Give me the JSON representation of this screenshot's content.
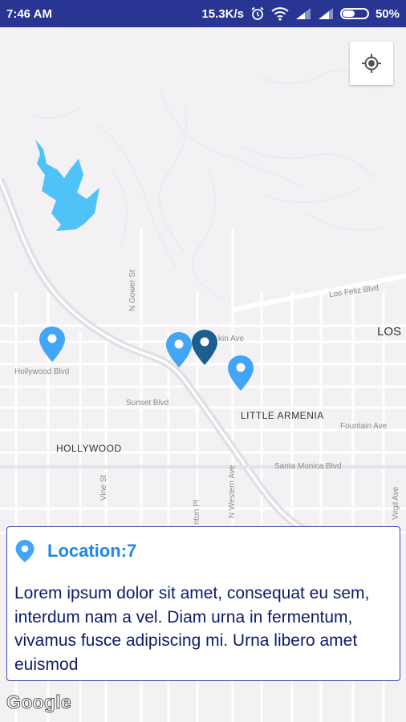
{
  "status_bar": {
    "time": "7:46 AM",
    "network_speed": "15.3K/s",
    "battery_percent": "50%",
    "battery_level": 0.5,
    "icons": [
      "alarm-icon",
      "wifi-icon",
      "signal-icon",
      "signal-icon",
      "battery-icon"
    ]
  },
  "map": {
    "labels": {
      "hollywood_blvd": "Hollywood Blvd",
      "sunset_blvd": "Sunset Blvd",
      "hollywood": "HOLLYWOOD",
      "little_armenia": "LITTLE ARMENIA",
      "los": "LOS",
      "los_feliz_blvd": "Los Feliz Blvd",
      "fountain_ave": "Fountain Ave",
      "santa_monica_blvd": "Santa Monica Blvd",
      "n_gower_st": "N Gower St",
      "vine_st": "Vine St",
      "n_western_ave": "N Western Ave",
      "virgil_ave": "Virgil Ave",
      "kin_ave": "kin Ave",
      "nton_pl": "nton Pl"
    },
    "my_location_icon": "crosshair-icon",
    "marker_color": "#42a5f5",
    "selected_marker_color": "#1c5f8f",
    "water_color": "#4fc3f7"
  },
  "info_card": {
    "icon": "location-pin-icon",
    "title": "Location:7",
    "description": "Lorem ipsum dolor sit amet, consequat eu sem, interdum nam a vel. Diam urna in fermentum, vivamus fusce adipiscing mi. Urna libero amet euismod"
  },
  "attribution": {
    "logo_text": "Google"
  }
}
